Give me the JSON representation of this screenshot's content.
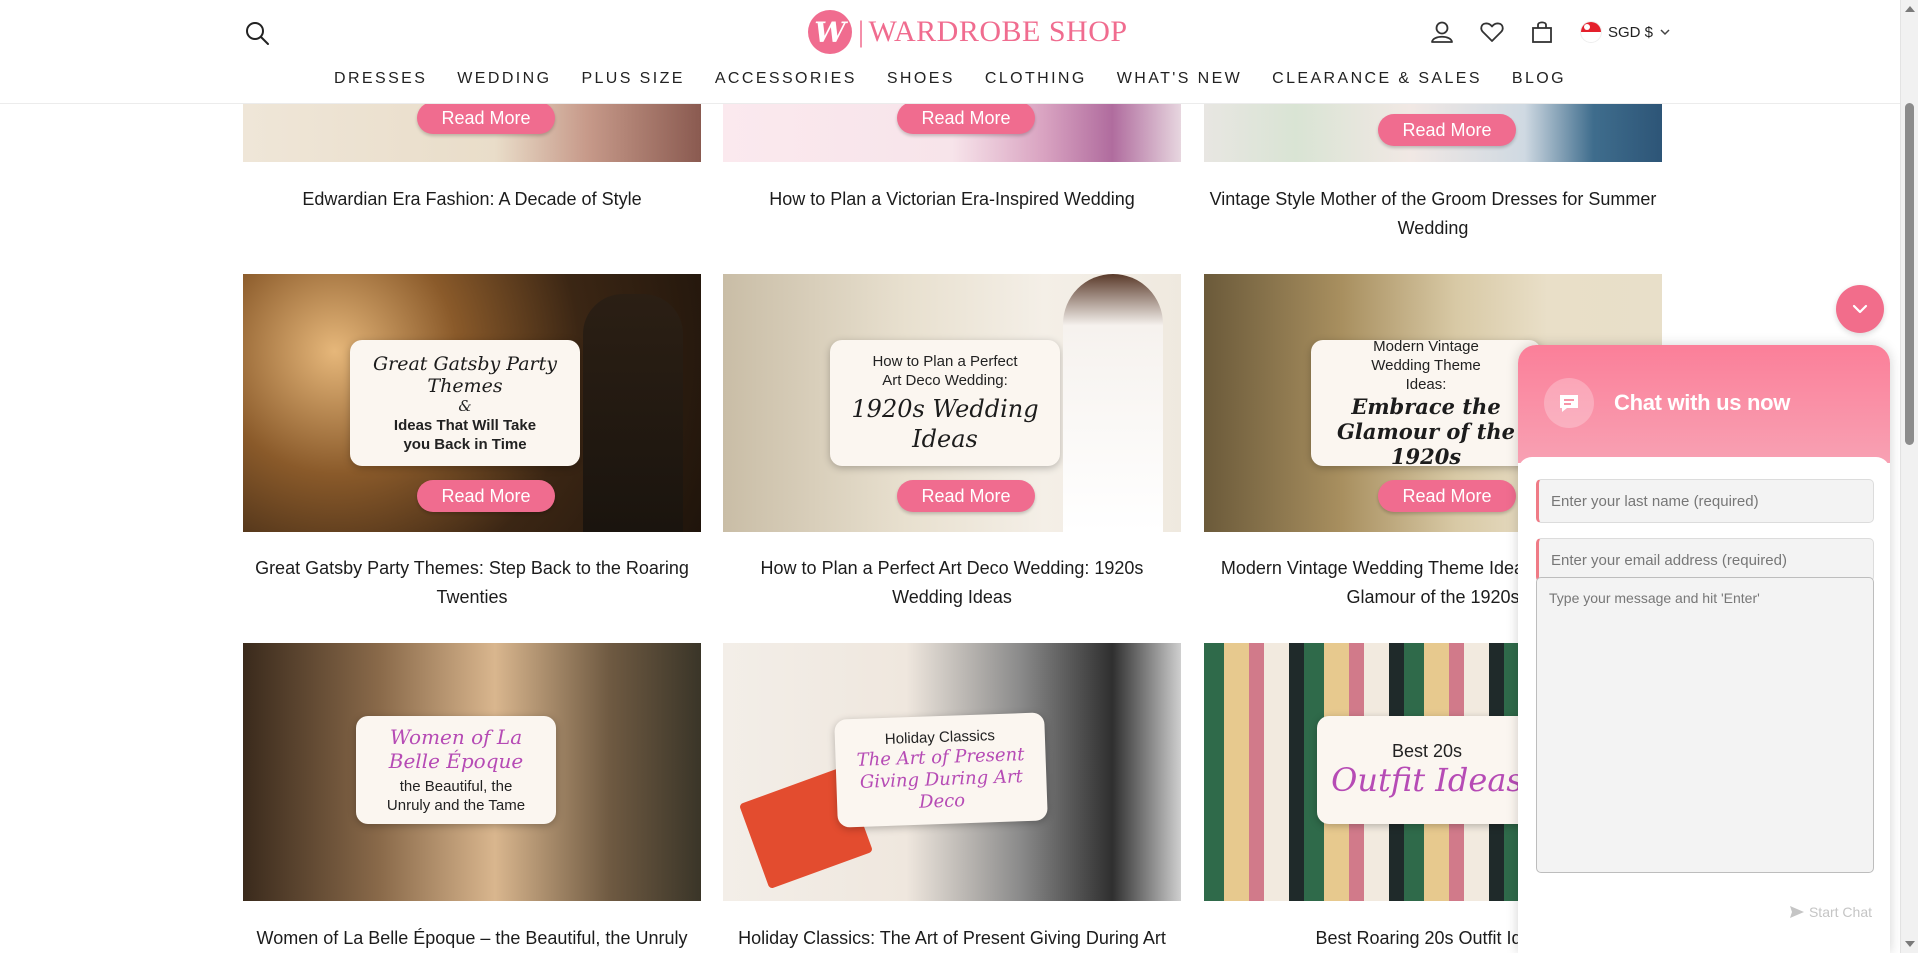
{
  "header": {
    "logo_mark": "W",
    "logo_text": "WARDROBE SHOP",
    "currency": "SGD $",
    "brand_color": "#f06c8f"
  },
  "nav": [
    {
      "label": "DRESSES"
    },
    {
      "label": "WEDDING"
    },
    {
      "label": "PLUS SIZE"
    },
    {
      "label": "ACCESSORIES"
    },
    {
      "label": "SHOES"
    },
    {
      "label": "CLOTHING"
    },
    {
      "label": "WHAT'S NEW"
    },
    {
      "label": "CLEARANCE & SALES"
    },
    {
      "label": "BLOG"
    }
  ],
  "read_more": "Read More",
  "row1": [
    {
      "title": "Edwardian Era Fashion: A Decade of Style"
    },
    {
      "title": "How to Plan a Victorian Era-Inspired Wedding"
    },
    {
      "title": "Vintage Style Mother of the Groom Dresses for Summer Wedding"
    }
  ],
  "row2": [
    {
      "title": "Great Gatsby Party Themes: Step Back to the Roaring Twenties",
      "ov_script": "Great Gatsby Party Themes",
      "ov_amp": "&",
      "ov_sub": "Ideas That Will Take you Back in Time"
    },
    {
      "title": "How to Plan a Perfect Art Deco Wedding: 1920s Wedding Ideas",
      "ov_top": "How to Plan a Perfect Art Deco Wedding:",
      "ov_script": "1920s Wedding Ideas"
    },
    {
      "title": "Modern Vintage Wedding Theme Ideas: Embrace the Glamour of the 1920s",
      "ov_top": "Modern Vintage Wedding Theme Ideas:",
      "ov_script": "Embrace the Glamour of the 1920s"
    }
  ],
  "row3": [
    {
      "title": "Women of La Belle Époque – the Beautiful, the Unruly",
      "ov_script": "Women of La Belle Époque",
      "ov_sub": "the Beautiful, the Unruly and the Tame"
    },
    {
      "title": "Holiday Classics: The Art of Present Giving During Art",
      "ov_top": "Holiday Classics",
      "ov_script": "The Art of Present Giving During Art Deco"
    },
    {
      "title": "Best Roaring 20s Outfit Ideas",
      "ov_top": "Best 20s",
      "ov_script": "Outfit Ideas"
    }
  ],
  "chat": {
    "title": "Chat with us now",
    "last_name_placeholder": "Enter your last name (required)",
    "email_placeholder": "Enter your email address (required)",
    "message_placeholder": "Type your message and hit 'Enter'",
    "send_label": "Start Chat"
  }
}
